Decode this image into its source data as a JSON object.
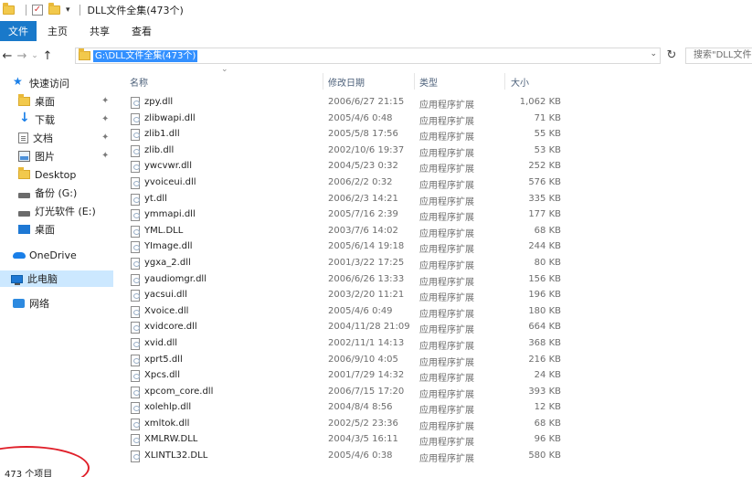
{
  "window": {
    "title": "DLL文件全集(473个)"
  },
  "ribbon": {
    "tabs": [
      "文件",
      "主页",
      "共享",
      "查看"
    ]
  },
  "address": {
    "path": "G:\\DLL文件全集(473个)",
    "search_placeholder": "搜索\"DLL文件"
  },
  "sidebar": {
    "quick_access": "快速访问",
    "items": [
      {
        "label": "桌面",
        "icon": "folder-icon",
        "pinned": true
      },
      {
        "label": "下载",
        "icon": "download-icon",
        "pinned": true
      },
      {
        "label": "文档",
        "icon": "document-icon",
        "pinned": true
      },
      {
        "label": "图片",
        "icon": "picture-icon",
        "pinned": true
      },
      {
        "label": "Desktop",
        "icon": "folder-icon",
        "pinned": false
      },
      {
        "label": "备份 (G:)",
        "icon": "drive-icon",
        "pinned": false
      },
      {
        "label": "灯光软件 (E:)",
        "icon": "drive-icon",
        "pinned": false
      },
      {
        "label": "桌面",
        "icon": "desktop-icon",
        "pinned": false
      }
    ],
    "onedrive": "OneDrive",
    "this_pc": "此电脑",
    "network": "网络"
  },
  "columns": {
    "name": "名称",
    "date": "修改日期",
    "type": "类型",
    "size": "大小"
  },
  "files": [
    {
      "name": "zpy.dll",
      "date": "2006/6/27 21:15",
      "type": "应用程序扩展",
      "size": "1,062 KB"
    },
    {
      "name": "zlibwapi.dll",
      "date": "2005/4/6 0:48",
      "type": "应用程序扩展",
      "size": "71 KB"
    },
    {
      "name": "zlib1.dll",
      "date": "2005/5/8 17:56",
      "type": "应用程序扩展",
      "size": "55 KB"
    },
    {
      "name": "zlib.dll",
      "date": "2002/10/6 19:37",
      "type": "应用程序扩展",
      "size": "53 KB"
    },
    {
      "name": "ywcvwr.dll",
      "date": "2004/5/23 0:32",
      "type": "应用程序扩展",
      "size": "252 KB"
    },
    {
      "name": "yvoiceui.dll",
      "date": "2006/2/2 0:32",
      "type": "应用程序扩展",
      "size": "576 KB"
    },
    {
      "name": "yt.dll",
      "date": "2006/2/3 14:21",
      "type": "应用程序扩展",
      "size": "335 KB"
    },
    {
      "name": "ymmapi.dll",
      "date": "2005/7/16 2:39",
      "type": "应用程序扩展",
      "size": "177 KB"
    },
    {
      "name": "YML.DLL",
      "date": "2003/7/6 14:02",
      "type": "应用程序扩展",
      "size": "68 KB"
    },
    {
      "name": "YImage.dll",
      "date": "2005/6/14 19:18",
      "type": "应用程序扩展",
      "size": "244 KB"
    },
    {
      "name": "ygxa_2.dll",
      "date": "2001/3/22 17:25",
      "type": "应用程序扩展",
      "size": "80 KB"
    },
    {
      "name": "yaudiomgr.dll",
      "date": "2006/6/26 13:33",
      "type": "应用程序扩展",
      "size": "156 KB"
    },
    {
      "name": "yacsui.dll",
      "date": "2003/2/20 11:21",
      "type": "应用程序扩展",
      "size": "196 KB"
    },
    {
      "name": "Xvoice.dll",
      "date": "2005/4/6 0:49",
      "type": "应用程序扩展",
      "size": "180 KB"
    },
    {
      "name": "xvidcore.dll",
      "date": "2004/11/28 21:09",
      "type": "应用程序扩展",
      "size": "664 KB"
    },
    {
      "name": "xvid.dll",
      "date": "2002/11/1 14:13",
      "type": "应用程序扩展",
      "size": "368 KB"
    },
    {
      "name": "xprt5.dll",
      "date": "2006/9/10 4:05",
      "type": "应用程序扩展",
      "size": "216 KB"
    },
    {
      "name": "Xpcs.dll",
      "date": "2001/7/29 14:32",
      "type": "应用程序扩展",
      "size": "24 KB"
    },
    {
      "name": "xpcom_core.dll",
      "date": "2006/7/15 17:20",
      "type": "应用程序扩展",
      "size": "393 KB"
    },
    {
      "name": "xolehlp.dll",
      "date": "2004/8/4 8:56",
      "type": "应用程序扩展",
      "size": "12 KB"
    },
    {
      "name": "xmltok.dll",
      "date": "2002/5/2 23:36",
      "type": "应用程序扩展",
      "size": "68 KB"
    },
    {
      "name": "XMLRW.DLL",
      "date": "2004/3/5 16:11",
      "type": "应用程序扩展",
      "size": "96 KB"
    },
    {
      "name": "XLINTL32.DLL",
      "date": "2005/4/6 0:38",
      "type": "应用程序扩展",
      "size": "580 KB"
    }
  ],
  "status": {
    "item_count": "473 个项目"
  },
  "colors": {
    "accent": "#1979ca",
    "selection": "#cce8ff",
    "annotation": "#e0202a"
  }
}
